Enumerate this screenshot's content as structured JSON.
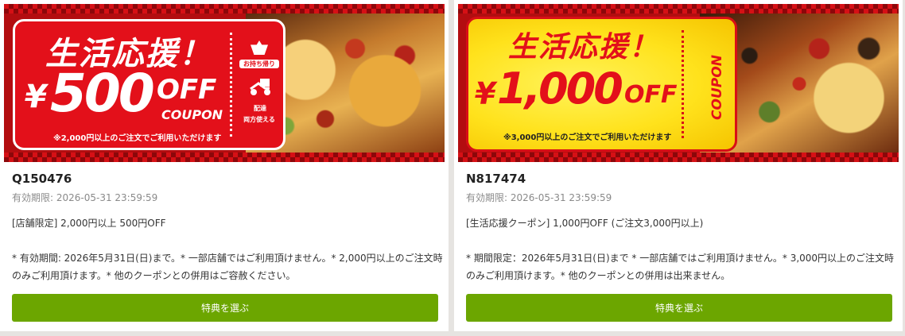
{
  "coupons": [
    {
      "banner": {
        "slogan": "生活応援！",
        "currency": "¥",
        "amount": "500",
        "off": "OFF",
        "coupon": "COUPON",
        "note": "※2,000円以上のご注文でご利用いただけます",
        "stub_takeout": "お持ち帰り",
        "stub_delivery": "配達",
        "stub_both": "両方使える"
      },
      "code": "Q150476",
      "expiry": "有効期限: 2026-05-31 23:59:59",
      "summary": "[店舗限定] 2,000円以上 500円OFF",
      "terms": "* 有効期間: 2026年5月31日(日)まで。* 一部店舗ではご利用頂けません。* 2,000円以上のご注文時のみご利用頂けます。* 他のクーポンとの併用はご容赦ください。",
      "button_label": "特典を選ぶ"
    },
    {
      "banner": {
        "slogan": "生活応援！",
        "currency": "¥",
        "amount": "1,000",
        "off": "OFF",
        "coupon": "COUPON",
        "note": "※3,000円以上のご注文でご利用いただけます"
      },
      "code": "N817474",
      "expiry": "有効期限: 2026-05-31 23:59:59",
      "summary": "[生活応援クーポン] 1,000円OFF (ご注文3,000円以上)",
      "terms": "* 期間限定：2026年5月31日(日)まで * 一部店舗ではご利用頂けません。* 3,000円以上のご注文時のみご利用頂けます。* 他のクーポンとの併用は出来ません。",
      "button_label": "特典を選ぶ"
    }
  ],
  "colors": {
    "button_green": "#6ca600",
    "coupon_red": "#e3101a",
    "coupon_gold": "#ffe21c",
    "page_background": "#e6e4e1"
  }
}
